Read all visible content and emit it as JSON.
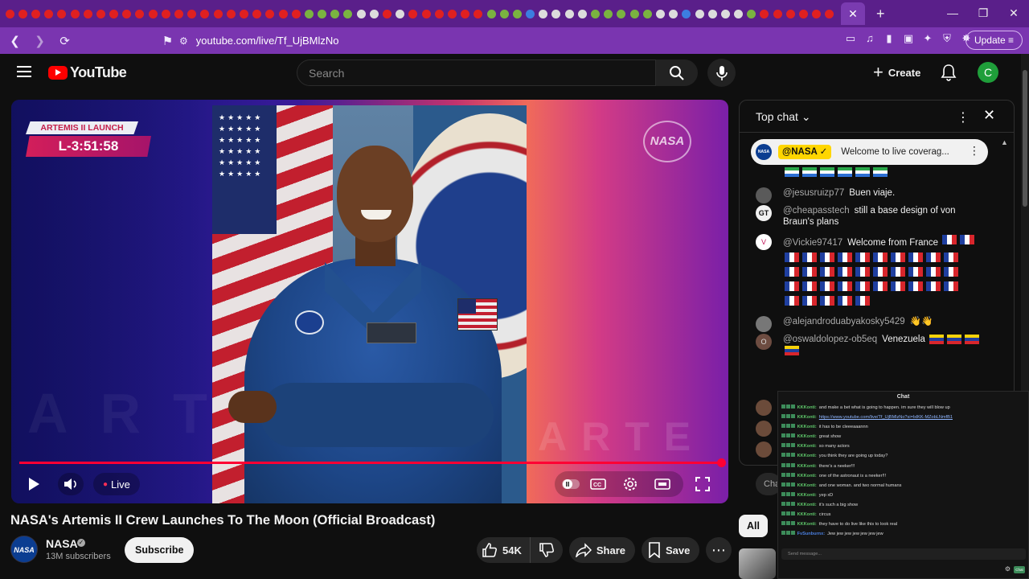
{
  "browser": {
    "url": "youtube.com/live/Tf_UjBMlzNo",
    "update_label": "Update",
    "new_tab_label": "+",
    "minimize": "—",
    "maximize": "❐",
    "close": "✕"
  },
  "header": {
    "logo_text": "YouTube",
    "search_placeholder": "Search",
    "create_label": "Create",
    "avatar_letter": "C"
  },
  "player": {
    "badge_event": "ARTEMIS II LAUNCH",
    "badge_countdown": "L-3:51:58",
    "watermark": "NASA",
    "ghost_text": "ARTE",
    "ghost_text2": "ARTE",
    "live_label": "Live",
    "progress": 1.0
  },
  "video": {
    "title": "NASA's Artemis II Crew Launches To The Moon (Official Broadcast)",
    "channel_name": "NASA",
    "channel_avatar": "NASA",
    "subscribers": "13M subscribers",
    "subscribe_label": "Subscribe",
    "likes": "54K",
    "share_label": "Share",
    "save_label": "Save"
  },
  "chat": {
    "title": "Top chat",
    "pinned": {
      "author": "@NASA ✓",
      "avatar": "NASA",
      "text": "Welcome to live coverag..."
    },
    "messages": [
      {
        "author": "@jesusruizp77",
        "text": "Buen viaje.",
        "avatar": ""
      },
      {
        "author": "@cheapasstech",
        "text": "still a base design of von Braun's plans",
        "avatar": "GT"
      },
      {
        "author": "@Vickie97417",
        "text": "Welcome from France",
        "avatar": "V"
      },
      {
        "author": "@alejandroduabyakosky5429",
        "text": "👋👋",
        "avatar": ""
      },
      {
        "author": "@oswaldolopez-ob5eq",
        "text": "Venezuela",
        "avatar": "O"
      }
    ],
    "input_stub": "Chat"
  },
  "stream_overlay": {
    "title": "Chat",
    "lines": [
      {
        "name": "KKKonti:",
        "text": "and make a bet what is going to happen. im sure they will blow up"
      },
      {
        "name": "KKKonti:",
        "text": "https://www.youtube.com/live/Tf_UjBMlzNo?si=lxlKK-MZobLNmfB1",
        "link": true
      },
      {
        "name": "KKKonti:",
        "text": "it has to be cleeeaaannn"
      },
      {
        "name": "KKKonti:",
        "text": "great show"
      },
      {
        "name": "KKKonti:",
        "text": "so many actors"
      },
      {
        "name": "KKKonti:",
        "text": "you think they are going up today?"
      },
      {
        "name": "KKKonti:",
        "text": "there's a neeker!!!"
      },
      {
        "name": "KKKonti:",
        "text": "one of the astronaut is a neeker!!!"
      },
      {
        "name": "KKKonti:",
        "text": "and one woman. and two normal humans"
      },
      {
        "name": "KKKonti:",
        "text": "yep xD"
      },
      {
        "name": "KKKonti:",
        "text": "it's such a big show"
      },
      {
        "name": "KKKonti:",
        "text": "circus"
      },
      {
        "name": "KKKonti:",
        "text": "they have to do live like this to look real"
      },
      {
        "name": "FvSunburnx:",
        "text": "Jew jew jew jew jew jew jew",
        "blue": true
      }
    ],
    "input_placeholder": "Send message...",
    "send_label": "Chat"
  },
  "sidebar": {
    "chip_all": "All"
  }
}
